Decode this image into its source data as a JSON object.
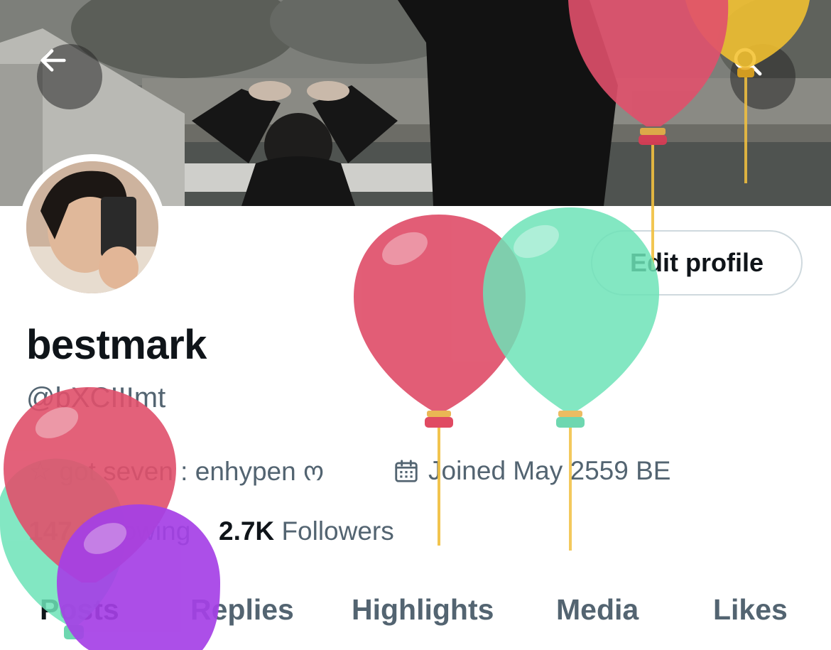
{
  "header": {
    "back_icon": "arrow-left-icon",
    "search_icon": "search-icon"
  },
  "profile": {
    "display_name": "bestmark",
    "handle": "@bXCIIImt",
    "bio": "☆ got seven : enhypen ო",
    "joined": "Joined May 2559 BE",
    "following_count": "147",
    "following_label": "Following",
    "followers_count": "2.7K",
    "followers_label": "Followers"
  },
  "actions": {
    "edit_profile": "Edit profile"
  },
  "tabs": [
    "Posts",
    "Replies",
    "Highlights",
    "Media",
    "Likes"
  ],
  "colors": {
    "text_primary": "#0f1419",
    "text_secondary": "#536471",
    "border": "#cfd9de",
    "balloon_red": "#e0506b",
    "balloon_green": "#6de3b8",
    "balloon_yellow": "#f4c230",
    "balloon_purple": "#a540e6"
  }
}
